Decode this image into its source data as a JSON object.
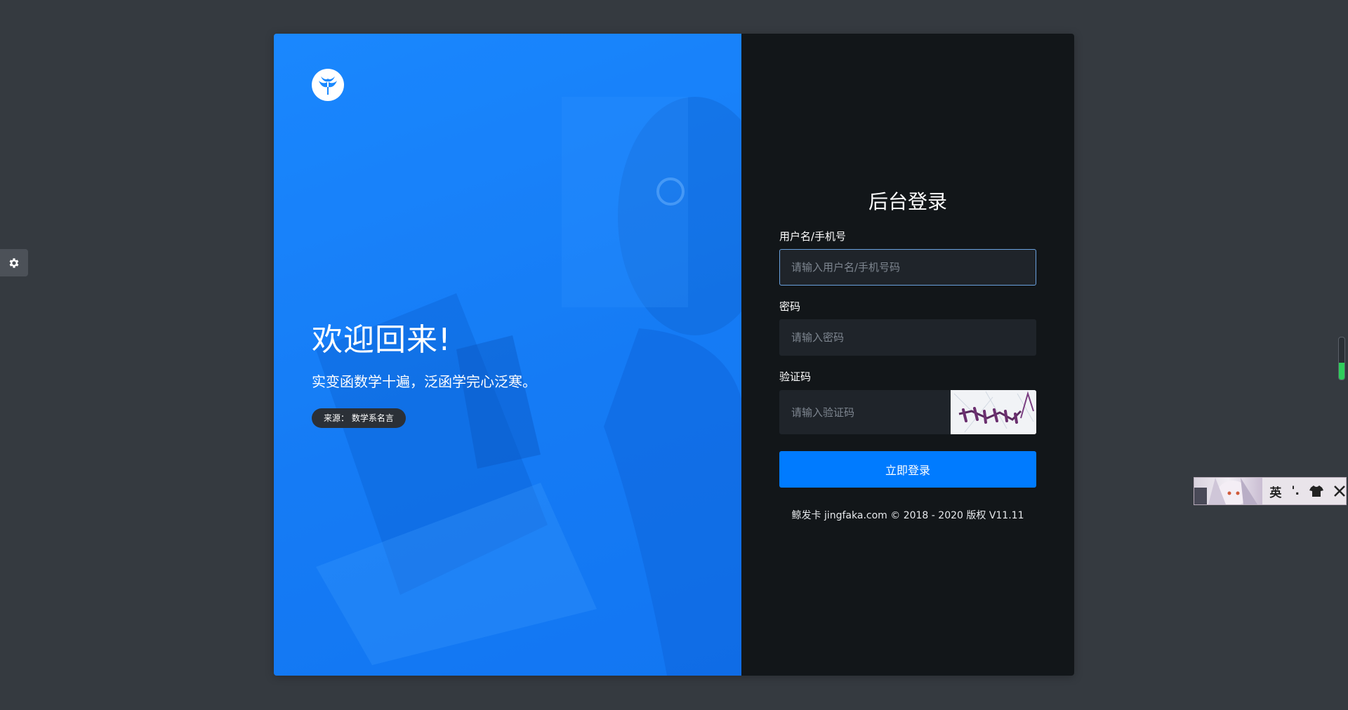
{
  "brand": {
    "accent": "#007bff",
    "panel_blue": "#1a89ff",
    "dark": "#121619"
  },
  "welcome": {
    "heading": "欢迎回来!",
    "quote": "实变函数学十遍，泛函学完心泛寒。",
    "source": "来源： 数学系名言"
  },
  "login": {
    "title": "后台登录",
    "username_label": "用户名/手机号",
    "username_placeholder": "请输入用户名/手机号码",
    "password_label": "密码",
    "password_placeholder": "请输入密码",
    "captcha_label": "验证码",
    "captcha_placeholder": "请输入验证码",
    "submit_label": "立即登录",
    "copyright": "鲸发卡 jingfaka.com © 2018 - 2020 版权 V11.11"
  },
  "ime": {
    "mode": "英",
    "punct": "'.",
    "skin_icon": "shirt-icon",
    "tools_icon": "tools-icon"
  },
  "icons": {
    "settings": "gear-icon",
    "logo": "whale-tail-logo"
  }
}
